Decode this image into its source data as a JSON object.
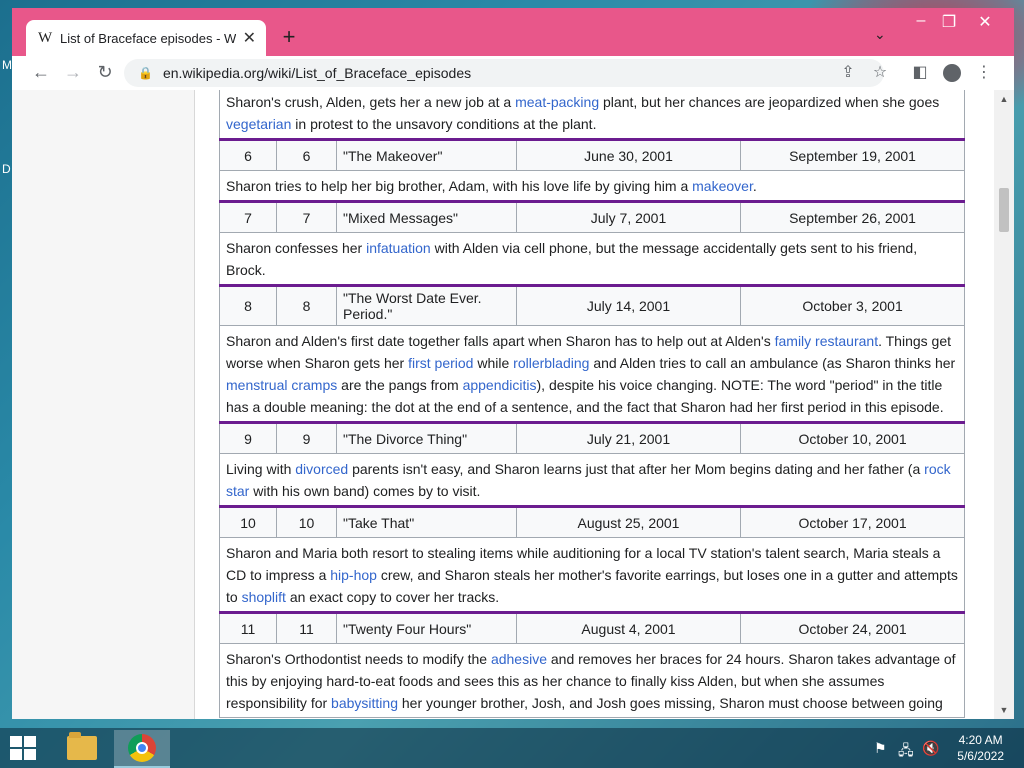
{
  "tab": {
    "title": "List of Braceface episodes - Wikipedia",
    "logo": "W"
  },
  "omnibox": {
    "url": "en.wikipedia.org/wiki/List_of_Braceface_episodes"
  },
  "desktop": {
    "letters": [
      "M",
      "D"
    ]
  },
  "episodes_top_desc": [
    {
      "t": "Sharon's crush, Alden, gets her a new job at a "
    },
    {
      "t": "meat-packing",
      "l": 1
    },
    {
      "t": " plant, but her chances are jeopardized when she goes "
    },
    {
      "t": "vegetarian",
      "l": 1
    },
    {
      "t": " in protest to the unsavory conditions at the plant."
    }
  ],
  "episodes": [
    {
      "no_overall": "6",
      "no_season": "6",
      "title": "\"The Makeover\"",
      "air_date": "June 30, 2001",
      "us_air_date": "September 19, 2001",
      "desc": [
        {
          "t": "Sharon tries to help her big brother, Adam, with his love life by giving him a "
        },
        {
          "t": "makeover",
          "l": 1
        },
        {
          "t": "."
        }
      ]
    },
    {
      "no_overall": "7",
      "no_season": "7",
      "title": "\"Mixed Messages\"",
      "air_date": "July 7, 2001",
      "us_air_date": "September 26, 2001",
      "desc": [
        {
          "t": "Sharon confesses her "
        },
        {
          "t": "infatuation",
          "l": 1
        },
        {
          "t": " with Alden via cell phone, but the message accidentally gets sent to his friend, Brock."
        }
      ]
    },
    {
      "no_overall": "8",
      "no_season": "8",
      "title": "\"The Worst Date Ever. Period.\"",
      "air_date": "July 14, 2001",
      "us_air_date": "October 3, 2001",
      "desc": [
        {
          "t": "Sharon and Alden's first date together falls apart when Sharon has to help out at Alden's "
        },
        {
          "t": "family restaurant",
          "l": 1
        },
        {
          "t": ". Things get worse when Sharon gets her "
        },
        {
          "t": "first period",
          "l": 1
        },
        {
          "t": " while "
        },
        {
          "t": "rollerblading",
          "l": 1
        },
        {
          "t": " and Alden tries to call an ambulance (as Sharon thinks her "
        },
        {
          "t": "menstrual cramps",
          "l": 1
        },
        {
          "t": " are the pangs from "
        },
        {
          "t": "appendicitis",
          "l": 1
        },
        {
          "t": "), despite his voice changing. NOTE: The word \"period\" in the title has a double meaning: the dot at the end of a sentence, and the fact that Sharon had her first period in this episode."
        }
      ]
    },
    {
      "no_overall": "9",
      "no_season": "9",
      "title": "\"The Divorce Thing\"",
      "air_date": "July 21, 2001",
      "us_air_date": "October 10, 2001",
      "desc": [
        {
          "t": "Living with "
        },
        {
          "t": "divorced",
          "l": 1
        },
        {
          "t": " parents isn't easy, and Sharon learns just that after her Mom begins dating and her father (a "
        },
        {
          "t": "rock star",
          "l": 1
        },
        {
          "t": " with his own band) comes by to visit."
        }
      ]
    },
    {
      "no_overall": "10",
      "no_season": "10",
      "title": "\"Take That\"",
      "air_date": "August 25, 2001",
      "us_air_date": "October 17, 2001",
      "desc": [
        {
          "t": "Sharon and Maria both resort to stealing items while auditioning for a local TV station's talent search, Maria steals a CD to impress a "
        },
        {
          "t": "hip-hop",
          "l": 1
        },
        {
          "t": " crew, and Sharon steals her mother's favorite earrings, but loses one in a gutter and attempts to "
        },
        {
          "t": "shoplift",
          "l": 1
        },
        {
          "t": " an exact copy to cover her tracks."
        }
      ]
    },
    {
      "no_overall": "11",
      "no_season": "11",
      "title": "\"Twenty Four Hours\"",
      "air_date": "August 4, 2001",
      "us_air_date": "October 24, 2001",
      "desc": [
        {
          "t": "Sharon's Orthodontist needs to modify the "
        },
        {
          "t": "adhesive",
          "l": 1
        },
        {
          "t": " and removes her braces for 24 hours. Sharon takes advantage of this by enjoying hard-to-eat foods and sees this as her chance to finally kiss Alden, but when she assumes responsibility for "
        },
        {
          "t": "babysitting",
          "l": 1
        },
        {
          "t": " her younger brother, Josh, and Josh goes missing, Sharon must choose between going"
        }
      ]
    }
  ],
  "taskbar": {
    "time": "4:20 AM",
    "date": "5/6/2022"
  },
  "colors": {
    "window_frame": "#e8578a",
    "link": "#3366cc",
    "row_separator": "#6b1c8f"
  }
}
